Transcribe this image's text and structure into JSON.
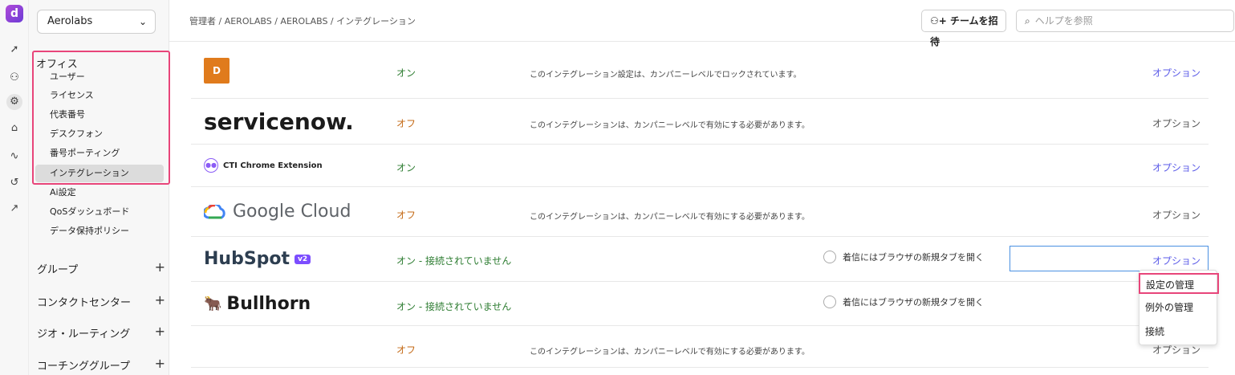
{
  "rail": {
    "logo_letter": "d"
  },
  "sidebar": {
    "org": "Aerolabs",
    "section": "オフィス",
    "items": [
      "ユーザー",
      "ライセンス",
      "代表番号",
      "デスクフォン",
      "番号ポーティング",
      "インテグレーション",
      "Ai設定",
      "QoSダッシュボード",
      "データ保持ポリシー"
    ],
    "groups": [
      "グループ",
      "コンタクトセンター",
      "ジオ・ルーティング",
      "コーチンググループ"
    ]
  },
  "header": {
    "breadcrumb": "管理者 / AEROLABS / AEROLABS / インテグレーション",
    "invite_label": "チームを招待",
    "help_placeholder": "ヘルプを参照"
  },
  "rows": [
    {
      "logo": "D",
      "status": "オン",
      "desc": "このインテグレーション設定は、カンパニーレベルでロックされています。",
      "option": "オプション"
    },
    {
      "logo": "servicenow.",
      "status": "オフ",
      "desc": "このインテグレーションは、カンパニーレベルで有効にする必要があります。",
      "option": "オプション"
    },
    {
      "logo": "CTI Chrome Extension",
      "status": "オン",
      "desc": "",
      "option": "オプション"
    },
    {
      "logo": "Google Cloud",
      "status": "オフ",
      "desc": "このインテグレーションは、カンパニーレベルで有効にする必要があります。",
      "option": "オプション"
    },
    {
      "logo": "HubSpot",
      "badge": "v2",
      "status": "オン - 接続されていません",
      "radio": "着信にはブラウザの新規タブを開く",
      "option": "オプション"
    },
    {
      "logo": "Bullhorn",
      "status": "オン - 接続されていません",
      "radio": "着信にはブラウザの新規タブを開く",
      "option": "オプション"
    },
    {
      "logo": "",
      "status": "オフ",
      "desc": "このインテグレーションは、カンパニーレベルで有効にする必要があります。",
      "option": "オプション"
    }
  ],
  "menu": [
    "設定の管理",
    "例外の管理",
    "接続"
  ],
  "colors": {
    "on": "#2e7d32",
    "off": "#c46a16",
    "link": "#5b5be8",
    "highlight": "#e8457a"
  }
}
